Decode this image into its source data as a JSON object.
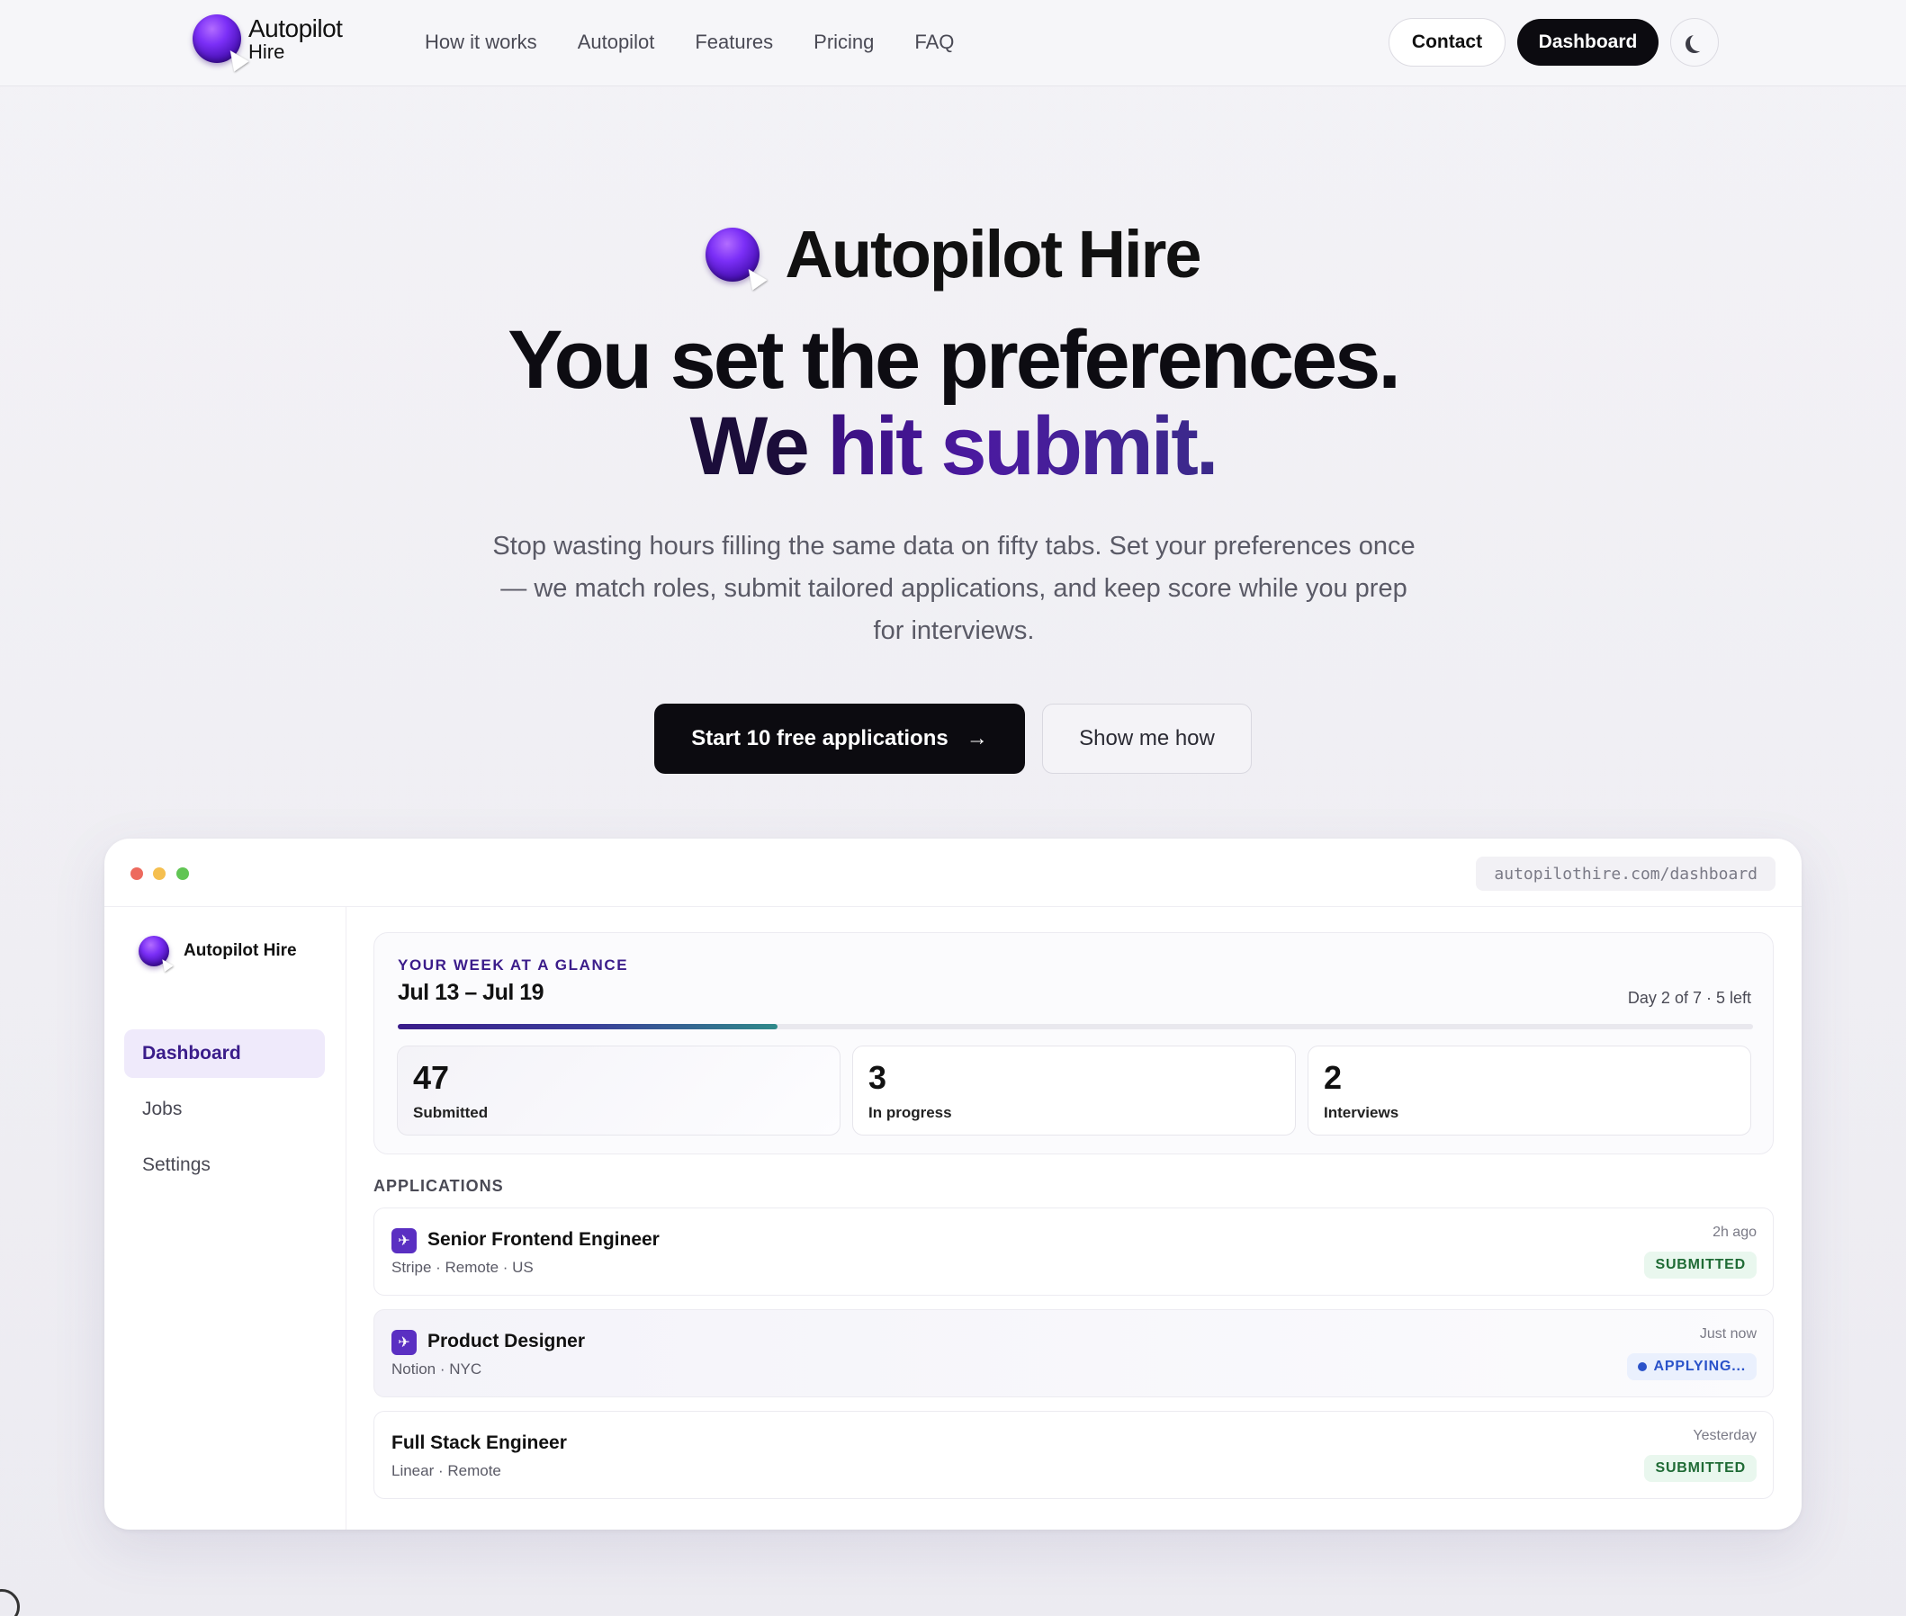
{
  "nav": {
    "brand_line1": "Autopilot",
    "brand_line2": "Hire",
    "links": [
      "How it works",
      "Autopilot",
      "Features",
      "Pricing",
      "FAQ"
    ],
    "contact": "Contact",
    "dashboard": "Dashboard",
    "theme_icon": "moon-icon"
  },
  "hero": {
    "brand": "Autopilot Hire",
    "headline_line1": "You set the preferences.",
    "headline_we": "We",
    "headline_rest": "hit submit.",
    "subtext": "Stop wasting hours filling the same data on fifty tabs. Set your preferences once — we match roles, submit tailored applications, and keep score while you prep for interviews.",
    "cta_primary": "Start 10 free applications",
    "cta_primary_icon": "→",
    "cta_secondary": "Show me how"
  },
  "window": {
    "url": "autopilothire.com/dashboard",
    "sidebar": {
      "brand": "Autopilot Hire",
      "items": [
        "Dashboard",
        "Jobs",
        "Settings"
      ],
      "active": "Dashboard"
    },
    "week": {
      "label": "YOUR WEEK AT A GLANCE",
      "range": "Jul 13 – Jul 19",
      "day_text": "Day 2 of 7 · 5 left",
      "progress": 0.28,
      "stats": [
        {
          "value": "47",
          "label": "Submitted"
        },
        {
          "value": "3",
          "label": "In progress"
        },
        {
          "value": "2",
          "label": "Interviews"
        }
      ]
    },
    "applications_label": "APPLICATIONS",
    "applications": [
      {
        "title": "Senior Frontend Engineer",
        "meta": "Stripe · Remote · US",
        "time": "2h ago",
        "status": "SUBMITTED",
        "has_icon": true
      },
      {
        "title": "Product Designer",
        "meta": "Notion · NYC",
        "time": "Just now",
        "status": "APPLYING...",
        "has_icon": true
      },
      {
        "title": "Full Stack Engineer",
        "meta": "Linear · Remote",
        "time": "Yesterday",
        "status": "SUBMITTED",
        "has_icon": false
      }
    ]
  },
  "colors": {
    "accent": "#3a1c8a",
    "brand_purple": "#7b2ff7",
    "dark": "#0c0b10",
    "submitted_green": "#1f6b35",
    "applying_blue": "#2a52c9"
  }
}
